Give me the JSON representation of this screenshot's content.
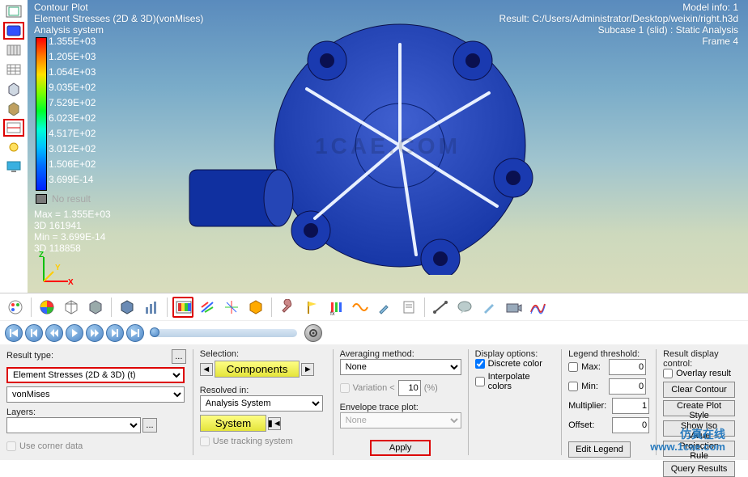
{
  "header": {
    "title": "Contour Plot",
    "subtitle": "Element Stresses (2D & 3D)(vonMises)",
    "system": "Analysis system",
    "model_info": "Model info: 1",
    "result_path": "Result: C:/Users/Administrator/Desktop/weixin/right.h3d",
    "subcase": "Subcase 1 (slid) : Static Analysis",
    "frame": "Frame 4"
  },
  "legend": {
    "values": [
      "1.355E+03",
      "1.205E+03",
      "1.054E+03",
      "9.035E+02",
      "7.529E+02",
      "6.023E+02",
      "4.517E+02",
      "3.012E+02",
      "1.506E+02",
      "3.699E-14"
    ],
    "no_result": "No result",
    "max": "Max = 1.355E+03",
    "max_id": "3D 161941",
    "min": "Min = 3.699E-14",
    "min_id": "3D 118858"
  },
  "watermark": {
    "center": "1CAE.COM",
    "corner_cn": "仿真在线",
    "corner_url": "www.1cae.com"
  },
  "panel": {
    "result_type": {
      "label": "Result type:",
      "value": "Element Stresses (2D & 3D) (t)",
      "sub_value": "vonMises"
    },
    "layers": {
      "label": "Layers:",
      "value": ""
    },
    "use_corner": "Use corner data",
    "selection": {
      "label": "Selection:",
      "btn": "Components"
    },
    "resolved": {
      "label": "Resolved in:",
      "value": "Analysis System",
      "sys_btn": "System",
      "use_tracking": "Use tracking system"
    },
    "averaging": {
      "label": "Averaging method:",
      "value": "None",
      "variation": "Variation <",
      "variation_val": "10",
      "variation_pct": "(%)"
    },
    "envelope": {
      "label": "Envelope trace plot:",
      "value": "None"
    },
    "apply": "Apply",
    "display": {
      "label": "Display options:",
      "discrete": "Discrete color",
      "interpolate": "Interpolate colors"
    },
    "legend_threshold": {
      "label": "Legend threshold:",
      "max": "Max:",
      "max_val": "0",
      "min": "Min:",
      "min_val": "0",
      "mult": "Multiplier:",
      "mult_val": "1",
      "offset": "Offset:",
      "offset_val": "0",
      "edit": "Edit Legend"
    },
    "result_display": {
      "label": "Result display control:",
      "overlay": "Overlay result",
      "clear": "Clear Contour",
      "plot_style": "Create Plot Style",
      "iso": "Show Iso Value",
      "proj_rule": "Projection Rule",
      "query": "Query Results"
    }
  }
}
